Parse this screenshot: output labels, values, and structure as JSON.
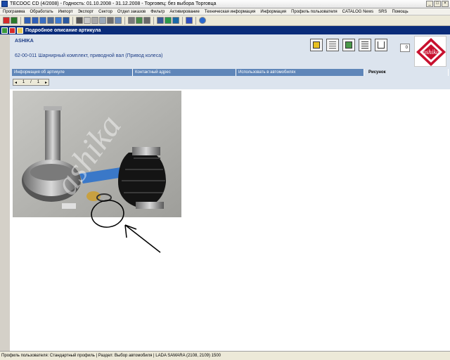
{
  "window": {
    "title": "TECDOC CD (4/2008)  -  Годность: 01.10.2008 - 31.12.2008  -  Торговец: без выбора Торговца",
    "controls": [
      "_",
      "□",
      "×"
    ]
  },
  "menu": [
    "Программа",
    "Обработать",
    "Импорт",
    "Экспорт",
    "Сектор",
    "Отдел заказов",
    "Фильтр",
    "Активирование",
    "Техническая информация",
    "Информация",
    "Профиль пользователя",
    "CATALOG News",
    "SRS",
    "Помощь"
  ],
  "panel": {
    "title": "Подробное описание артикула"
  },
  "article": {
    "supplier": "ASHIKA",
    "description": "62-00-011 Шарнирный комплект, приводной вал (Привод колеса)",
    "cart_count": "0",
    "logo_text": "ashika"
  },
  "tabs": [
    {
      "label": "Информация об артикуле"
    },
    {
      "label": "Контактный адрес"
    },
    {
      "label": "Использовать в автомобилях"
    },
    {
      "label": "Рисунок"
    }
  ],
  "pager": {
    "prev": "◂",
    "current": "1",
    "sep": "/",
    "total": "1",
    "next": "▸"
  },
  "image": {
    "watermark": "ashika"
  },
  "status": {
    "text": "Профиль пользователя: Стандартный профиль | Раздел: Выбор автомобиля | LADA SAMARA (2108, 2109) 1500"
  }
}
